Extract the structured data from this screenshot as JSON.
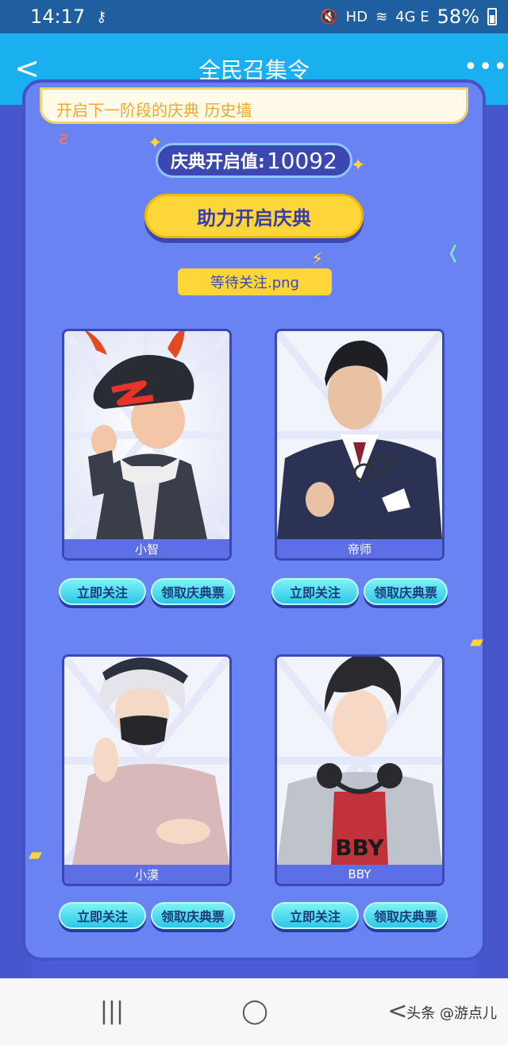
{
  "status_bar": {
    "time": "14:17",
    "key_icon": "⚷",
    "signal_text": "HD",
    "network": "4G E",
    "battery_pct": "58%"
  },
  "header": {
    "title": "全民召集令",
    "back_icon": "<",
    "more_icon": "•••"
  },
  "banner_text": "开启下一阶段的庆典   历史墙",
  "celebration": {
    "label": "庆典开启值:",
    "value": "10092"
  },
  "main_button": "助力开启庆典",
  "waiting_tag": "等待关注.png",
  "cards": [
    {
      "name": "小智",
      "follow": "立即关注",
      "ticket": "领取庆典票"
    },
    {
      "name": "帝师",
      "follow": "立即关注",
      "ticket": "领取庆典票"
    },
    {
      "name": "小漠",
      "follow": "立即关注",
      "ticket": "领取庆典票"
    },
    {
      "name": "BBY",
      "follow": "立即关注",
      "ticket": "领取庆典票"
    }
  ],
  "nav": {
    "recent": "|||",
    "home": "◯",
    "back": "<",
    "watermark": "头条 @游点儿"
  },
  "colors": {
    "accent": "#1ab0f0",
    "panel": "#6a83f2",
    "button_yellow": "#ffd63a",
    "button_cyan": "#2ec7e6"
  }
}
